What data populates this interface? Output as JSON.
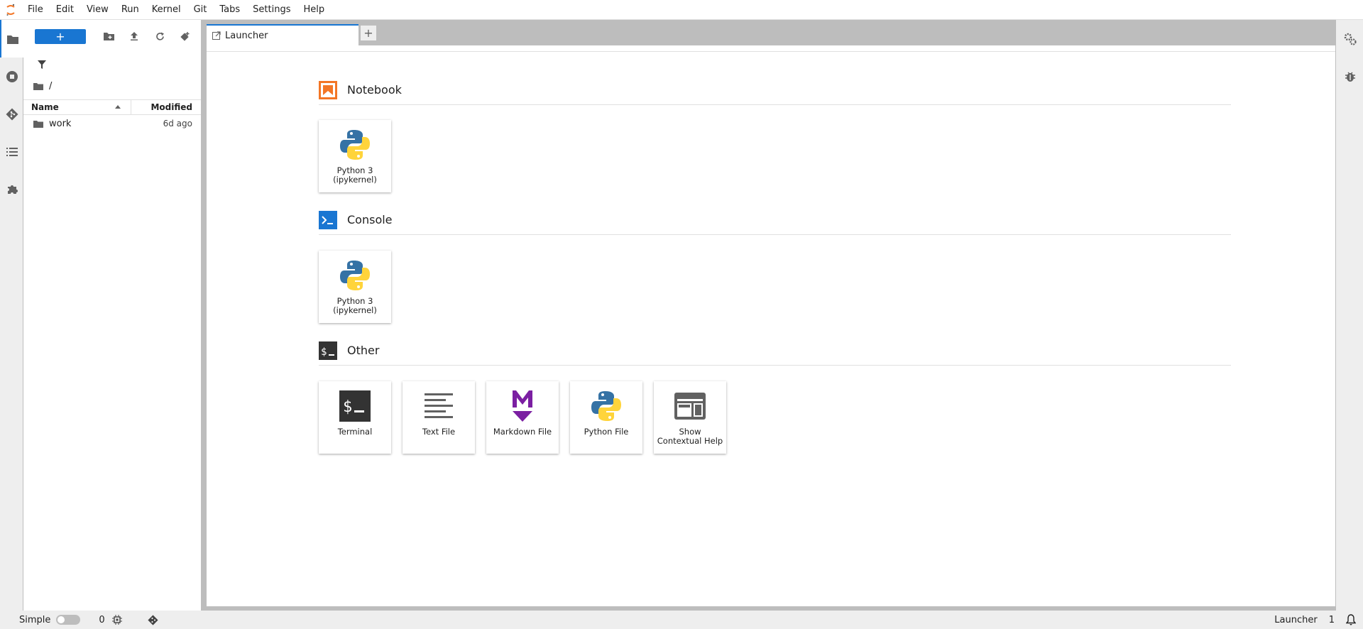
{
  "menubar": {
    "items": [
      "File",
      "Edit",
      "View",
      "Run",
      "Kernel",
      "Git",
      "Tabs",
      "Settings",
      "Help"
    ]
  },
  "filebrowser": {
    "path": "/",
    "columns": {
      "name": "Name",
      "modified": "Modified"
    },
    "rows": [
      {
        "name": "work",
        "modified": "6d ago"
      }
    ]
  },
  "tabs": {
    "active_label": "Launcher"
  },
  "launcher": {
    "sections": [
      {
        "title": "Notebook",
        "cards": [
          "Python 3 (ipykernel)"
        ]
      },
      {
        "title": "Console",
        "cards": [
          "Python 3 (ipykernel)"
        ]
      },
      {
        "title": "Other",
        "cards": [
          "Terminal",
          "Text File",
          "Markdown File",
          "Python File",
          "Show Contextual Help"
        ]
      }
    ]
  },
  "statusbar": {
    "mode_label": "Simple",
    "kernel_count": "0",
    "active_label": "Launcher",
    "notification_count": "1"
  },
  "colors": {
    "accent": "#1976d2",
    "notebook_orange": "#f37626",
    "markdown_purple": "#7b1fa2",
    "terminal_dark": "#333333"
  },
  "icons": {
    "leftbar": [
      "folder-icon",
      "running-icon",
      "git-icon",
      "toc-icon",
      "extension-icon"
    ],
    "rightbar": [
      "property-inspector-icon",
      "debugger-icon"
    ]
  }
}
